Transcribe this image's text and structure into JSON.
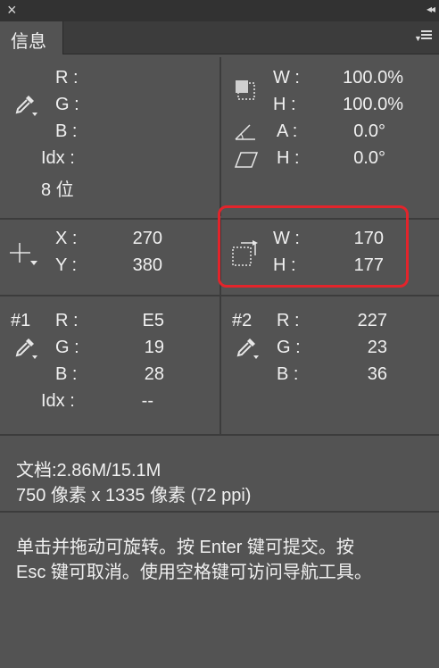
{
  "window": {
    "close_glyph": "×",
    "collapse_glyph": "◂◂",
    "tab_label": "信息",
    "panel_menu_icon": "panel-menu-icon"
  },
  "rgb_readout": {
    "r_label": "R :",
    "g_label": "G :",
    "b_label": "B :",
    "idx_label": "Idx :",
    "bit_depth": "8 位",
    "icon": "eyedropper-icon"
  },
  "scale": {
    "w_label": "W :",
    "w_value": "100.0%",
    "h_label": "H :",
    "h_value": "100.0%",
    "a_label": "A :",
    "a_value": "0.0°",
    "skew_label": "H :",
    "skew_value": "0.0°"
  },
  "position": {
    "x_label": "X :",
    "x_value": "270",
    "y_label": "Y :",
    "y_value": "380",
    "icon": "crosshair-icon"
  },
  "selection_size": {
    "w_label": "W :",
    "w_value": "170",
    "h_label": "H :",
    "h_value": "177",
    "icon": "selection-size-icon",
    "highlight_color": "#e3242b"
  },
  "sampler1": {
    "label": "#1",
    "r_label": "R :",
    "r_value": "E5",
    "g_label": "G :",
    "g_value": "19",
    "b_label": "B :",
    "b_value": "28",
    "idx_label": "Idx :",
    "idx_value": "--"
  },
  "sampler2": {
    "label": "#2",
    "r_label": "R :",
    "r_value": "227",
    "g_label": "G :",
    "g_value": "23",
    "b_label": "B :",
    "b_value": "36"
  },
  "document": {
    "size": "文档:2.86M/15.1M",
    "dimensions": "750 像素 x 1335 像素 (72 ppi)"
  },
  "hint": {
    "line1": "单击并拖动可旋转。按 Enter 键可提交。按",
    "line2": "Esc 键可取消。使用空格键可访问导航工具。"
  }
}
